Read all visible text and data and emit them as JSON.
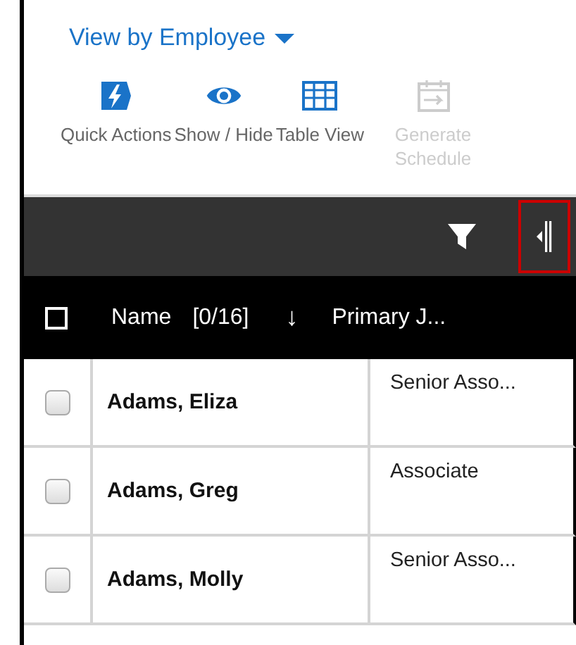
{
  "view_selector": {
    "label": "View by Employee"
  },
  "toolbar": [
    {
      "kind": "bolt",
      "label": "Quick Actions",
      "disabled": false
    },
    {
      "kind": "eye",
      "label": "Show / Hide",
      "disabled": false
    },
    {
      "kind": "grid",
      "label": "Table View",
      "disabled": false
    },
    {
      "kind": "calendar",
      "label": "Generate Schedule",
      "disabled": true
    }
  ],
  "filter_bar": {
    "collapse_highlighted": true
  },
  "table": {
    "header_checked": false,
    "columns": [
      {
        "label": "Name",
        "count": "[0/16]",
        "sort": "↓"
      },
      {
        "label": "Primary J..."
      }
    ],
    "rows": [
      {
        "name": "Adams, Eliza",
        "job": "Senior Asso...",
        "checked": false
      },
      {
        "name": "Adams, Greg",
        "job": "Associate",
        "checked": false
      },
      {
        "name": "Adams, Molly",
        "job": "Senior Asso...",
        "checked": false
      }
    ]
  }
}
